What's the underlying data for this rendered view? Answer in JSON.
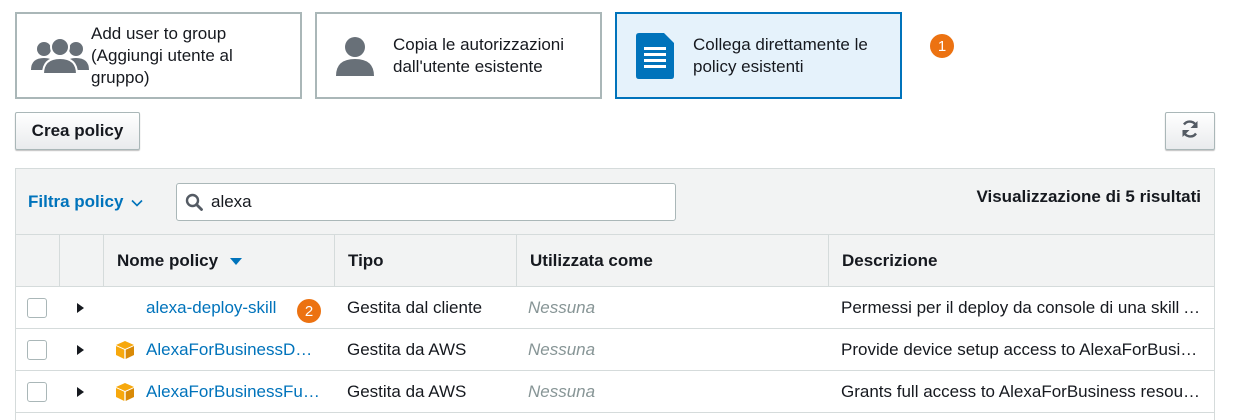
{
  "options": {
    "add_to_group": {
      "label": "Add user to group (Aggiungi utente al gruppo)",
      "icon": "user-group-icon"
    },
    "copy_permissions": {
      "label": "Copia le autorizzazioni dall'utente esistente",
      "icon": "user-icon"
    },
    "attach_policies": {
      "label": "Collega direttamente le policy esistenti",
      "icon": "document-icon",
      "selected": true
    }
  },
  "badges": {
    "step1": "1",
    "step2": "2"
  },
  "toolbar": {
    "create_policy_label": "Crea policy",
    "refresh_icon": "refresh-icon"
  },
  "filter": {
    "label": "Filtra policy",
    "search_value": "alexa",
    "result_count": "Visualizzazione di 5 risultati"
  },
  "table": {
    "columns": [
      "Nome policy",
      "Tipo",
      "Utilizzata come",
      "Descrizione"
    ],
    "rows": [
      {
        "name": "alexa-deploy-skill",
        "type": "Gestita dal cliente",
        "used_as": "Nessuna",
        "description": "Permessi per il deploy da console di una skill Alexa",
        "icon": ""
      },
      {
        "name": "AlexaForBusinessDeviceSetup",
        "type": "Gestita da AWS",
        "used_as": "Nessuna",
        "description": "Provide device setup access to AlexaForBusiness services",
        "icon": "aws-cube-icon"
      },
      {
        "name": "AlexaForBusinessFullAccess",
        "type": "Gestita da AWS",
        "used_as": "Nessuna",
        "description": "Grants full access to AlexaForBusiness resources",
        "icon": "aws-cube-icon"
      }
    ]
  },
  "colors": {
    "accent": "#0073bb",
    "badge": "#ec7211",
    "selected_bg": "#e5f2fb",
    "aws_cube": "#f7a80d"
  }
}
